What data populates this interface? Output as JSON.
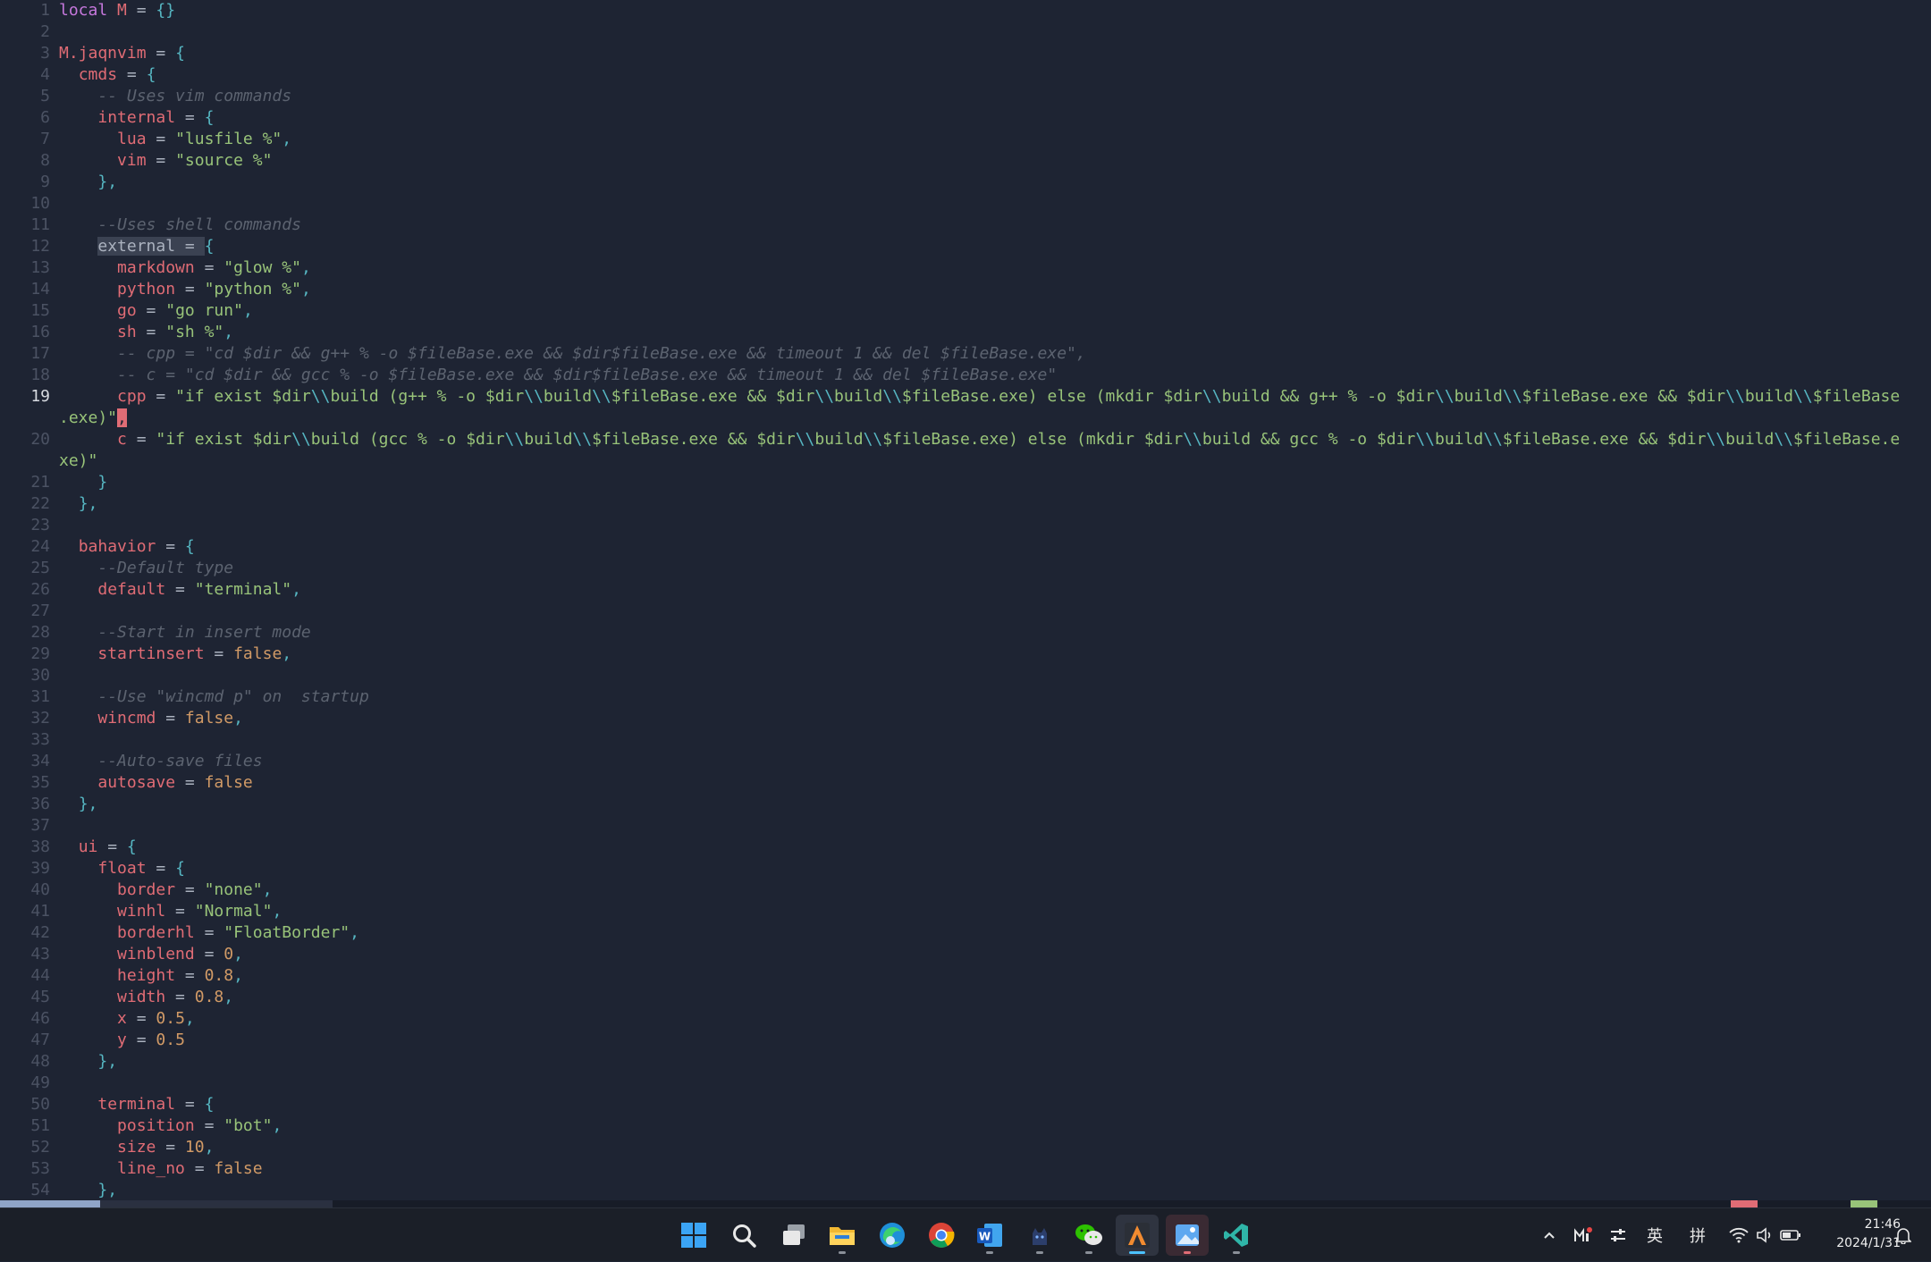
{
  "editor": {
    "cursor_line": 19,
    "lines": [
      {
        "n": "1",
        "t": [
          [
            "kw",
            "local"
          ],
          [
            "op",
            " "
          ],
          [
            "id",
            "M"
          ],
          [
            "op",
            " = "
          ],
          [
            "pun",
            "{}"
          ]
        ]
      },
      {
        "n": "2",
        "t": []
      },
      {
        "n": "3",
        "t": [
          [
            "id",
            "M.jaqnvim"
          ],
          [
            "op",
            " = "
          ],
          [
            "pun",
            "{"
          ]
        ]
      },
      {
        "n": "4",
        "t": [
          [
            "op",
            "  "
          ],
          [
            "id",
            "cmds"
          ],
          [
            "op",
            " = "
          ],
          [
            "pun",
            "{"
          ]
        ]
      },
      {
        "n": "5",
        "t": [
          [
            "op",
            "    "
          ],
          [
            "cmt",
            "-- Uses vim commands"
          ]
        ]
      },
      {
        "n": "6",
        "t": [
          [
            "op",
            "    "
          ],
          [
            "id",
            "internal"
          ],
          [
            "op",
            " = "
          ],
          [
            "pun",
            "{"
          ]
        ]
      },
      {
        "n": "7",
        "t": [
          [
            "op",
            "      "
          ],
          [
            "id",
            "lua"
          ],
          [
            "op",
            " = "
          ],
          [
            "str",
            "\"lusfile %\""
          ],
          [
            "pun",
            ","
          ]
        ]
      },
      {
        "n": "8",
        "t": [
          [
            "op",
            "      "
          ],
          [
            "id",
            "vim"
          ],
          [
            "op",
            " = "
          ],
          [
            "str",
            "\"source %\""
          ]
        ]
      },
      {
        "n": "9",
        "t": [
          [
            "op",
            "    "
          ],
          [
            "pun",
            "},"
          ]
        ]
      },
      {
        "n": "10",
        "t": []
      },
      {
        "n": "11",
        "t": [
          [
            "op",
            "    "
          ],
          [
            "cmt",
            "--Uses shell commands"
          ]
        ]
      },
      {
        "n": "12",
        "t": [
          [
            "op",
            "    "
          ],
          [
            "sel",
            "external = "
          ],
          [
            "pun",
            "{"
          ]
        ]
      },
      {
        "n": "13",
        "t": [
          [
            "op",
            "      "
          ],
          [
            "id",
            "markdown"
          ],
          [
            "op",
            " = "
          ],
          [
            "str",
            "\"glow %\""
          ],
          [
            "pun",
            ","
          ]
        ]
      },
      {
        "n": "14",
        "t": [
          [
            "op",
            "      "
          ],
          [
            "id",
            "python"
          ],
          [
            "op",
            " = "
          ],
          [
            "str",
            "\"python %\""
          ],
          [
            "pun",
            ","
          ]
        ]
      },
      {
        "n": "15",
        "t": [
          [
            "op",
            "      "
          ],
          [
            "id",
            "go"
          ],
          [
            "op",
            " = "
          ],
          [
            "str",
            "\"go run\""
          ],
          [
            "pun",
            ","
          ]
        ]
      },
      {
        "n": "16",
        "t": [
          [
            "op",
            "      "
          ],
          [
            "id",
            "sh"
          ],
          [
            "op",
            " = "
          ],
          [
            "str",
            "\"sh %\""
          ],
          [
            "pun",
            ","
          ]
        ]
      },
      {
        "n": "17",
        "t": [
          [
            "op",
            "      "
          ],
          [
            "cmt",
            "-- cpp = \"cd $dir && g++ % -o $fileBase.exe && $dir$fileBase.exe && timeout 1 && del $fileBase.exe\","
          ]
        ]
      },
      {
        "n": "18",
        "t": [
          [
            "op",
            "      "
          ],
          [
            "cmt",
            "-- c = \"cd $dir && gcc % -o $fileBase.exe && $dir$fileBase.exe && timeout 1 && del $fileBase.exe\""
          ]
        ]
      },
      {
        "n": "19",
        "t": [
          [
            "op",
            "      "
          ],
          [
            "id",
            "cpp"
          ],
          [
            "op",
            " = "
          ],
          [
            "str",
            "\"if exist $dir"
          ],
          [
            "pun",
            "\\\\"
          ],
          [
            "str",
            "build (g++ % -o $dir"
          ],
          [
            "pun",
            "\\\\"
          ],
          [
            "str",
            "build"
          ],
          [
            "pun",
            "\\\\"
          ],
          [
            "str",
            "$fileBase.exe && $dir"
          ],
          [
            "pun",
            "\\\\"
          ],
          [
            "str",
            "build"
          ],
          [
            "pun",
            "\\\\"
          ],
          [
            "str",
            "$fileBase.exe) else (mkdir $dir"
          ],
          [
            "pun",
            "\\\\"
          ],
          [
            "str",
            "build && g++ % -o $dir"
          ],
          [
            "pun",
            "\\\\"
          ],
          [
            "str",
            "build"
          ],
          [
            "pun",
            "\\\\"
          ],
          [
            "str",
            "$fileBase.exe && $dir"
          ],
          [
            "pun",
            "\\\\"
          ],
          [
            "str",
            "build"
          ],
          [
            "pun",
            "\\\\"
          ],
          [
            "str",
            "$fileBase"
          ]
        ]
      },
      {
        "n": "",
        "t": [
          [
            "str",
            ".exe)\""
          ],
          [
            "cursor",
            ","
          ]
        ]
      },
      {
        "n": "20",
        "t": [
          [
            "op",
            "      "
          ],
          [
            "id",
            "c"
          ],
          [
            "op",
            " = "
          ],
          [
            "str",
            "\"if exist $dir"
          ],
          [
            "pun",
            "\\\\"
          ],
          [
            "str",
            "build (gcc % -o $dir"
          ],
          [
            "pun",
            "\\\\"
          ],
          [
            "str",
            "build"
          ],
          [
            "pun",
            "\\\\"
          ],
          [
            "str",
            "$fileBase.exe && $dir"
          ],
          [
            "pun",
            "\\\\"
          ],
          [
            "str",
            "build"
          ],
          [
            "pun",
            "\\\\"
          ],
          [
            "str",
            "$fileBase.exe) else (mkdir $dir"
          ],
          [
            "pun",
            "\\\\"
          ],
          [
            "str",
            "build && gcc % -o $dir"
          ],
          [
            "pun",
            "\\\\"
          ],
          [
            "str",
            "build"
          ],
          [
            "pun",
            "\\\\"
          ],
          [
            "str",
            "$fileBase.exe && $dir"
          ],
          [
            "pun",
            "\\\\"
          ],
          [
            "str",
            "build"
          ],
          [
            "pun",
            "\\\\"
          ],
          [
            "str",
            "$fileBase.e"
          ]
        ]
      },
      {
        "n": "",
        "t": [
          [
            "str",
            "xe)\""
          ]
        ]
      },
      {
        "n": "21",
        "t": [
          [
            "op",
            "    "
          ],
          [
            "pun",
            "}"
          ]
        ]
      },
      {
        "n": "22",
        "t": [
          [
            "op",
            "  "
          ],
          [
            "pun",
            "},"
          ]
        ]
      },
      {
        "n": "23",
        "t": []
      },
      {
        "n": "24",
        "t": [
          [
            "op",
            "  "
          ],
          [
            "id",
            "bahavior"
          ],
          [
            "op",
            " = "
          ],
          [
            "pun",
            "{"
          ]
        ]
      },
      {
        "n": "25",
        "t": [
          [
            "op",
            "    "
          ],
          [
            "cmt",
            "--Default type"
          ]
        ]
      },
      {
        "n": "26",
        "t": [
          [
            "op",
            "    "
          ],
          [
            "id",
            "default"
          ],
          [
            "op",
            " = "
          ],
          [
            "str",
            "\"terminal\""
          ],
          [
            "pun",
            ","
          ]
        ]
      },
      {
        "n": "27",
        "t": []
      },
      {
        "n": "28",
        "t": [
          [
            "op",
            "    "
          ],
          [
            "cmt",
            "--Start in insert mode"
          ]
        ]
      },
      {
        "n": "29",
        "t": [
          [
            "op",
            "    "
          ],
          [
            "id",
            "startinsert"
          ],
          [
            "op",
            " = "
          ],
          [
            "bool",
            "false"
          ],
          [
            "pun",
            ","
          ]
        ]
      },
      {
        "n": "30",
        "t": []
      },
      {
        "n": "31",
        "t": [
          [
            "op",
            "    "
          ],
          [
            "cmt",
            "--Use \"wincmd p\" on  startup"
          ]
        ]
      },
      {
        "n": "32",
        "t": [
          [
            "op",
            "    "
          ],
          [
            "id",
            "wincmd"
          ],
          [
            "op",
            " = "
          ],
          [
            "bool",
            "false"
          ],
          [
            "pun",
            ","
          ]
        ]
      },
      {
        "n": "33",
        "t": []
      },
      {
        "n": "34",
        "t": [
          [
            "op",
            "    "
          ],
          [
            "cmt",
            "--Auto-save files"
          ]
        ]
      },
      {
        "n": "35",
        "t": [
          [
            "op",
            "    "
          ],
          [
            "id",
            "autosave"
          ],
          [
            "op",
            " = "
          ],
          [
            "bool",
            "false"
          ]
        ]
      },
      {
        "n": "36",
        "t": [
          [
            "op",
            "  "
          ],
          [
            "pun",
            "},"
          ]
        ]
      },
      {
        "n": "37",
        "t": []
      },
      {
        "n": "38",
        "t": [
          [
            "op",
            "  "
          ],
          [
            "id",
            "ui"
          ],
          [
            "op",
            " = "
          ],
          [
            "pun",
            "{"
          ]
        ]
      },
      {
        "n": "39",
        "t": [
          [
            "op",
            "    "
          ],
          [
            "id",
            "float"
          ],
          [
            "op",
            " = "
          ],
          [
            "pun",
            "{"
          ]
        ]
      },
      {
        "n": "40",
        "t": [
          [
            "op",
            "      "
          ],
          [
            "id",
            "border"
          ],
          [
            "op",
            " = "
          ],
          [
            "str",
            "\"none\""
          ],
          [
            "pun",
            ","
          ]
        ]
      },
      {
        "n": "41",
        "t": [
          [
            "op",
            "      "
          ],
          [
            "id",
            "winhl"
          ],
          [
            "op",
            " = "
          ],
          [
            "str",
            "\"Normal\""
          ],
          [
            "pun",
            ","
          ]
        ]
      },
      {
        "n": "42",
        "t": [
          [
            "op",
            "      "
          ],
          [
            "id",
            "borderhl"
          ],
          [
            "op",
            " = "
          ],
          [
            "str",
            "\"FloatBorder\""
          ],
          [
            "pun",
            ","
          ]
        ]
      },
      {
        "n": "43",
        "t": [
          [
            "op",
            "      "
          ],
          [
            "id",
            "winblend"
          ],
          [
            "op",
            " = "
          ],
          [
            "num",
            "0"
          ],
          [
            "pun",
            ","
          ]
        ]
      },
      {
        "n": "44",
        "t": [
          [
            "op",
            "      "
          ],
          [
            "id",
            "height"
          ],
          [
            "op",
            " = "
          ],
          [
            "num",
            "0.8"
          ],
          [
            "pun",
            ","
          ]
        ]
      },
      {
        "n": "45",
        "t": [
          [
            "op",
            "      "
          ],
          [
            "id",
            "width"
          ],
          [
            "op",
            " = "
          ],
          [
            "num",
            "0.8"
          ],
          [
            "pun",
            ","
          ]
        ]
      },
      {
        "n": "46",
        "t": [
          [
            "op",
            "      "
          ],
          [
            "id",
            "x"
          ],
          [
            "op",
            " = "
          ],
          [
            "num",
            "0.5"
          ],
          [
            "pun",
            ","
          ]
        ]
      },
      {
        "n": "47",
        "t": [
          [
            "op",
            "      "
          ],
          [
            "id",
            "y"
          ],
          [
            "op",
            " = "
          ],
          [
            "num",
            "0.5"
          ]
        ]
      },
      {
        "n": "48",
        "t": [
          [
            "op",
            "    "
          ],
          [
            "pun",
            "},"
          ]
        ]
      },
      {
        "n": "49",
        "t": []
      },
      {
        "n": "50",
        "t": [
          [
            "op",
            "    "
          ],
          [
            "id",
            "terminal"
          ],
          [
            "op",
            " = "
          ],
          [
            "pun",
            "{"
          ]
        ]
      },
      {
        "n": "51",
        "t": [
          [
            "op",
            "      "
          ],
          [
            "id",
            "position"
          ],
          [
            "op",
            " = "
          ],
          [
            "str",
            "\"bot\""
          ],
          [
            "pun",
            ","
          ]
        ]
      },
      {
        "n": "52",
        "t": [
          [
            "op",
            "      "
          ],
          [
            "id",
            "size"
          ],
          [
            "op",
            " = "
          ],
          [
            "num",
            "10"
          ],
          [
            "pun",
            ","
          ]
        ]
      },
      {
        "n": "53",
        "t": [
          [
            "op",
            "      "
          ],
          [
            "id",
            "line_no"
          ],
          [
            "op",
            " = "
          ],
          [
            "bool",
            "false"
          ]
        ]
      },
      {
        "n": "54",
        "t": [
          [
            "op",
            "    "
          ],
          [
            "pun",
            "},"
          ]
        ]
      }
    ]
  },
  "statusline": {
    "colors": {
      "mode": "#8fa4c7",
      "mid": "#2a3040",
      "error": "#e06c75",
      "ok": "#98c379"
    }
  },
  "taskbar": {
    "apps": [
      {
        "name": "start-button",
        "icon": "windows-logo-icon",
        "active": false,
        "running": false
      },
      {
        "name": "search-button",
        "icon": "search-icon",
        "active": false,
        "running": false
      },
      {
        "name": "task-view-button",
        "icon": "task-view-icon",
        "active": false,
        "running": false
      },
      {
        "name": "file-explorer-button",
        "icon": "folder-icon",
        "active": false,
        "running": true
      },
      {
        "name": "edge-button",
        "icon": "edge-icon",
        "active": false,
        "running": false
      },
      {
        "name": "chrome-button",
        "icon": "chrome-icon",
        "active": false,
        "running": false
      },
      {
        "name": "word-button",
        "icon": "word-icon",
        "active": false,
        "running": true
      },
      {
        "name": "cat-app-button",
        "icon": "cat-icon",
        "active": false,
        "running": true
      },
      {
        "name": "wechat-button",
        "icon": "wechat-icon",
        "active": false,
        "running": true
      },
      {
        "name": "alacritty-button",
        "icon": "alacritty-icon",
        "active": true,
        "running": true
      },
      {
        "name": "image-app-button",
        "icon": "image-icon",
        "active": false,
        "running": true,
        "highlight": true
      },
      {
        "name": "vscode-button",
        "icon": "vscode-icon",
        "active": false,
        "running": true
      }
    ],
    "tray": {
      "ime_lang": "英",
      "ime_mode": "拼",
      "time": "21:46",
      "date": "2024/1/31"
    }
  }
}
